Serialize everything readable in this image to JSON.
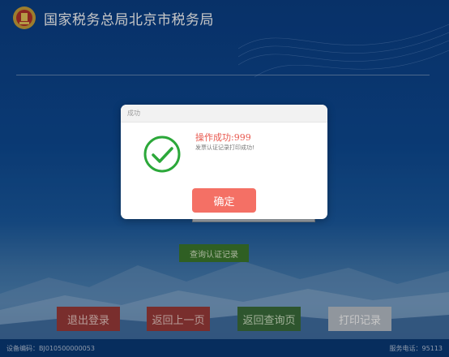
{
  "header": {
    "title": "国家税务总局北京市税务局"
  },
  "main": {
    "query_button": "查询认证记录"
  },
  "bottom_buttons": {
    "logout": "退出登录",
    "back": "返回上一页",
    "return_query": "返回查询页",
    "print_record": "打印记录"
  },
  "footer": {
    "device_label": "设备编码：",
    "device_code": "BJ010500000053",
    "service_label": "服务电话：",
    "service_phone": "95113"
  },
  "dialog": {
    "title": "成功",
    "message": "操作成功:999",
    "detail": "发票认证记录打印成功!",
    "confirm": "确定",
    "icon": "success-check-icon"
  },
  "colors": {
    "background": "#0d4a94",
    "dialog_accent": "#f47065",
    "success_green": "#2ca83a",
    "error_red": "#9c3c3a"
  }
}
